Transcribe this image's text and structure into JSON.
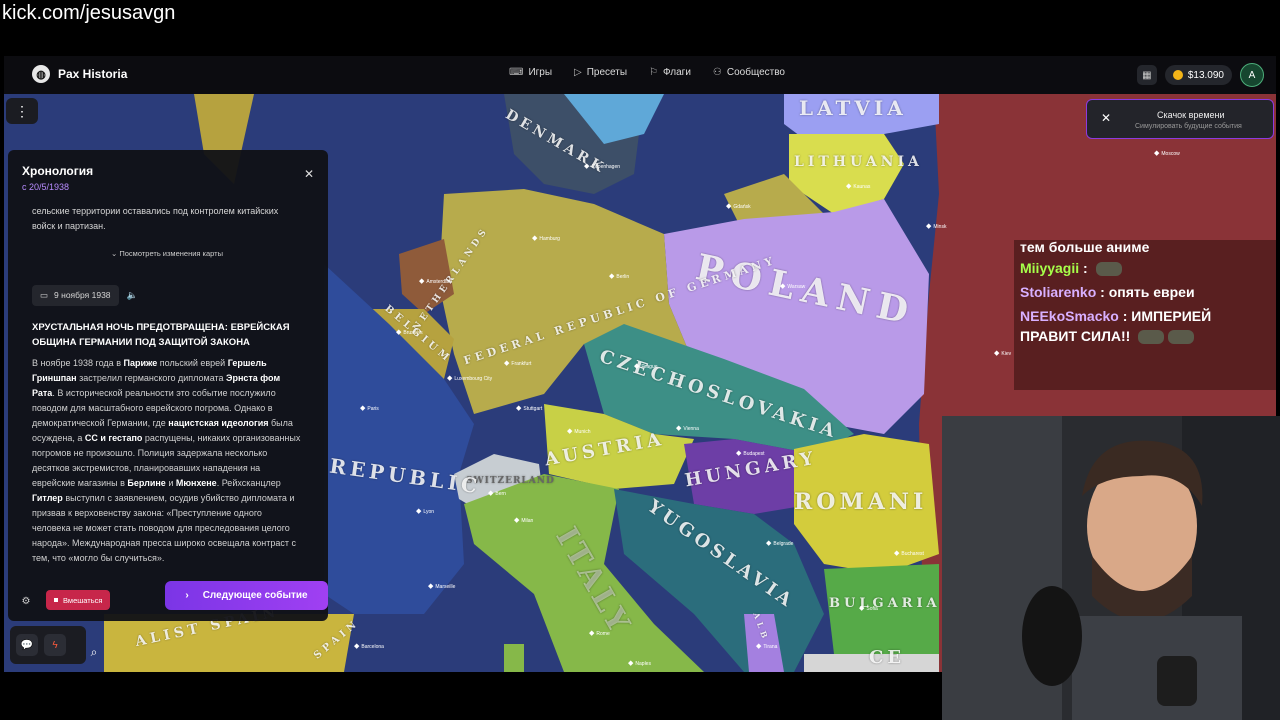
{
  "stream_url": "kick.com/jesusavgn",
  "app": {
    "name": "Pax Historia",
    "nav": [
      {
        "label": "Игры",
        "icon": "gamepad-icon"
      },
      {
        "label": "Пресеты",
        "icon": "play-icon"
      },
      {
        "label": "Флаги",
        "icon": "flag-icon"
      },
      {
        "label": "Сообщество",
        "icon": "users-icon"
      }
    ],
    "balance": "$13.090",
    "avatar_letter": "A"
  },
  "time_jump": {
    "title": "Скачок времени",
    "subtitle": "Симулировать будущие события"
  },
  "timeline": {
    "title": "Хронология",
    "since": "с 20/5/1938",
    "prev_text": "сельские территории оставались под контролем китайских войск и партизан.",
    "view_changes": "Посмотреть изменения карты",
    "event_date": "9 ноября 1938",
    "event_title": "ХРУСТАЛЬНАЯ НОЧЬ ПРЕДОТВРАЩЕНА: ЕВРЕЙСКАЯ ОБЩИНА ГЕРМАНИИ ПОД ЗАЩИТОЙ ЗАКОНА",
    "event_text": {
      "p1": "В ноябре 1938 года в ",
      "b1": "Париже",
      "p2": " польский еврей ",
      "b2": "Гершель Гриншпан",
      "p3": " застрелил германского дипломата ",
      "b3": "Эрнста фом Рата",
      "p4": ". В исторической реальности это событие послужило поводом для масштабного еврейского погрома. Однако в демократической Германии, где ",
      "b4": "нацистская идеология",
      "p5": " была осуждена, а ",
      "b5": "СС и гестапо",
      "p6": " распущены, никаких организованных погромов не произошло. Полиция задержала несколько десятков экстремистов, планировавших нападения на еврейские магазины в ",
      "b6": "Берлине",
      "p7": " и ",
      "b7": "Мюнхене",
      "p8": ". Рейхсканцлер ",
      "b8": "Гитлер",
      "p9": " выступил с заявлением, осудив убийство дипломата и призвав к верховенству закона: «Преступление одного человека не может стать поводом для преследования целого народа». Международная пресса широко освещала контраст с тем, что «могло бы случиться»."
    },
    "interfere_label": "Вмешаться",
    "next_label": "Следующее событие"
  },
  "map": {
    "labels": [
      {
        "text": "LATVIA",
        "color": "#9b9ff2"
      },
      {
        "text": "LITHUANIA",
        "color": "#d9dd4e"
      },
      {
        "text": "DENMARK",
        "color": "#3d4f68"
      },
      {
        "text": "POLAND",
        "color": "#b99ae8"
      },
      {
        "text": "FEDERAL REPUBLIC OF GERMANY",
        "color": "#b7ab4c"
      },
      {
        "text": "NETHERLANDS",
        "color": "#8f5b3a"
      },
      {
        "text": "BELGIUM",
        "color": "#b6a23f"
      },
      {
        "text": "CZECHOSLOVAKIA",
        "color": "#3d8f86"
      },
      {
        "text": "AUSTRIA",
        "color": "#c8d046"
      },
      {
        "text": "HUNGARY",
        "color": "#6d3ea6"
      },
      {
        "text": "SWITZERLAND",
        "color": "#c7cdd2"
      },
      {
        "text": "REPUBLIC",
        "color": "#2f4c9b"
      },
      {
        "text": "ROMANI",
        "color": "#d3cc3c"
      },
      {
        "text": "YUGOSLAVIA",
        "color": "#2b6d7c"
      },
      {
        "text": "BULGARIA",
        "color": "#56aa48"
      },
      {
        "text": "ITALY",
        "color": "#86b849"
      },
      {
        "text": "ALIST SPAIN",
        "color": "#c9b53e"
      },
      {
        "text": "SPAIN",
        "color": "#c9b53e"
      },
      {
        "text": "ALB",
        "color": "#a480e0"
      },
      {
        "text": "CE",
        "color": "#d6d6d6"
      }
    ],
    "cities": [
      "Copenhagen",
      "Gdańsk",
      "Kaunas",
      "Hamburg",
      "Berlin",
      "Warsaw",
      "Amsterdam",
      "Brussels",
      "Frankfurt",
      "Luxembourg City",
      "Prague",
      "Paris",
      "Stuttgart",
      "Munich",
      "Vienna",
      "Budapest",
      "Bern",
      "Lyon",
      "Milan",
      "Belgrade",
      "Bucharest",
      "Marseille",
      "Sofia",
      "Rome",
      "Barcelona",
      "Naples",
      "Tirana",
      "Minsk",
      "Kiev",
      "Moscow"
    ]
  },
  "chat": [
    {
      "user": "",
      "message": "тем больше аниме"
    },
    {
      "user": "Miiyyagii",
      "message": ""
    },
    {
      "user": "Stoliarenko",
      "message": "опять евреи"
    },
    {
      "user": "NEEkoSmacko",
      "message": "ИМПЕРИЕЙ ПРАВИТ СИЛА!!"
    }
  ]
}
